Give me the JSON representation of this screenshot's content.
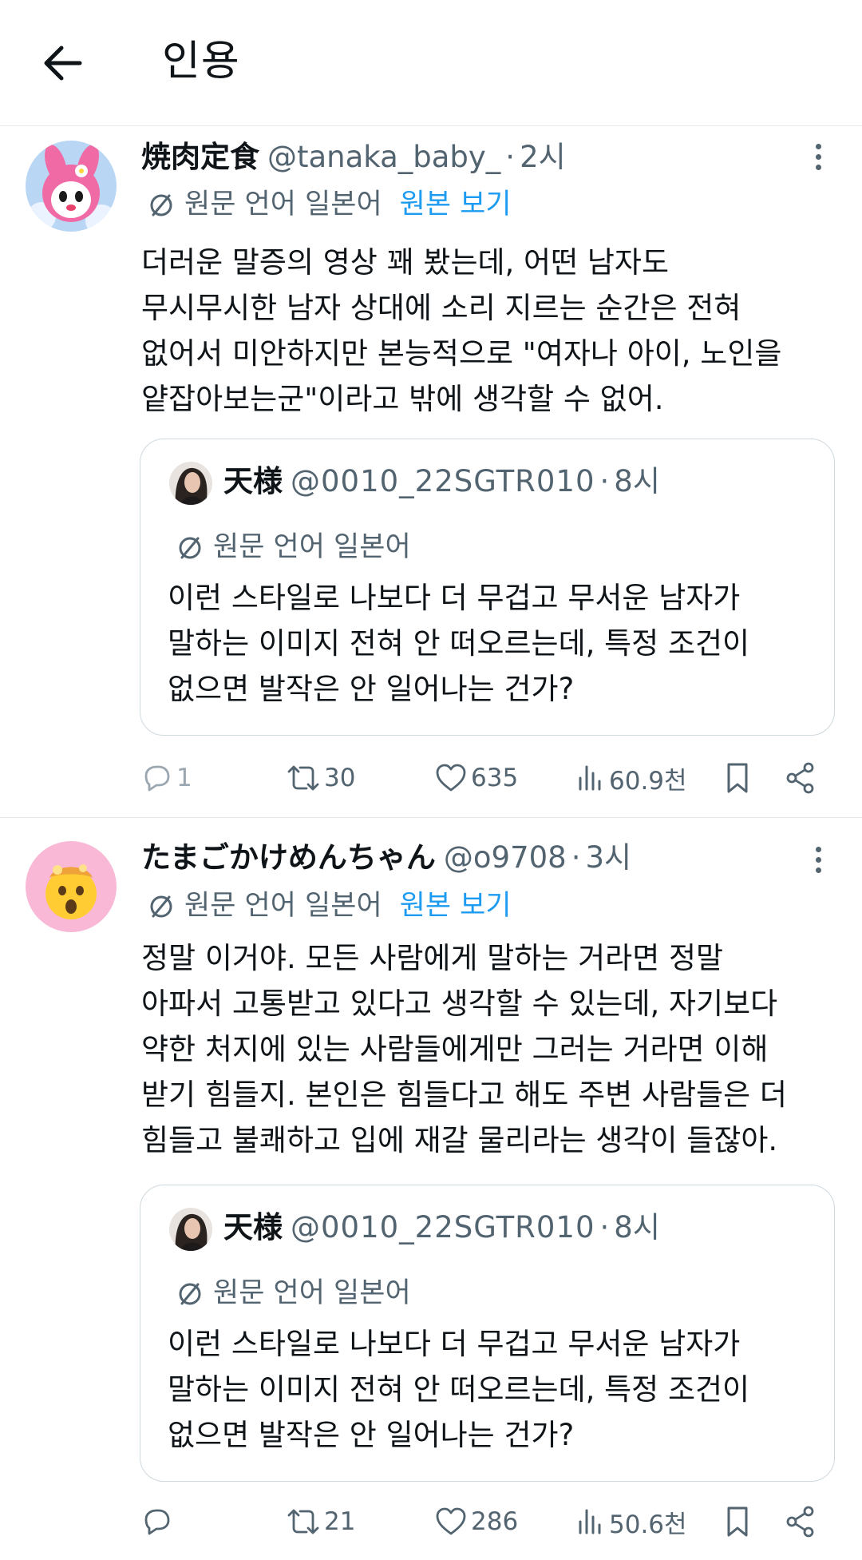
{
  "header": {
    "title": "인용"
  },
  "posts": [
    {
      "display_name": "焼肉定食",
      "handle": "@tanaka_baby_",
      "time": "2시",
      "translation_label": "원문 언어 일본어",
      "view_original": "원본 보기",
      "lines": [
        "더러운 말증의 영상 꽤 봤는데, 어떤 남자도",
        "무시무시한 남자 상대에 소리 지르는 순간은 전혀",
        "없어서 미안하지만 본능적으로 \"여자나 아이, 노인을",
        "얕잡아보는군\"이라고 밖에 생각할 수 없어."
      ],
      "quote": {
        "display_name": "天様",
        "handle": "@0010_22SGTR010",
        "time": "8시",
        "translation_label": "원문 언어 일본어",
        "lines": [
          "이런 스타일로 나보다 더 무겁고 무서운 남자가",
          "말하는 이미지 전혀 안 떠오르는데, 특정 조건이",
          "없으면 발작은 안 일어나는 건가?"
        ]
      },
      "stats": {
        "replies": "1",
        "reposts": "30",
        "likes": "635",
        "views": "60.9천"
      }
    },
    {
      "display_name": "たまごかけめんちゃん",
      "handle": "@o9708",
      "time": "3시",
      "translation_label": "원문 언어 일본어",
      "view_original": "원본 보기",
      "lines": [
        "정말 이거야. 모든 사람에게 말하는 거라면 정말",
        "아파서 고통받고 있다고 생각할 수 있는데, 자기보다",
        "약한 처지에 있는 사람들에게만 그러는 거라면 이해",
        "받기 힘들지. 본인은 힘들다고 해도 주변 사람들은 더",
        "힘들고 불쾌하고 입에 재갈 물리라는 생각이 들잖아."
      ],
      "quote": {
        "display_name": "天様",
        "handle": "@0010_22SGTR010",
        "time": "8시",
        "translation_label": "원문 언어 일본어",
        "lines": [
          "이런 스타일로 나보다 더 무겁고 무서운 남자가",
          "말하는 이미지 전혀 안 떠오르는데, 특정 조건이",
          "없으면 발작은 안 일어나는 건가?"
        ]
      },
      "stats": {
        "replies": "",
        "reposts": "21",
        "likes": "286",
        "views": "50.6천"
      }
    }
  ],
  "icons": {
    "back": "arrow-left-icon",
    "more": "more-vertical-icon",
    "translate": "translate-icon",
    "reply": "reply-icon",
    "repost": "repost-icon",
    "like": "heart-icon",
    "views": "views-icon",
    "bookmark": "bookmark-icon",
    "share": "share-icon"
  },
  "colors": {
    "text": "#0f1419",
    "muted": "#536471",
    "link": "#1d9bf0",
    "border": "#cfd9de"
  }
}
